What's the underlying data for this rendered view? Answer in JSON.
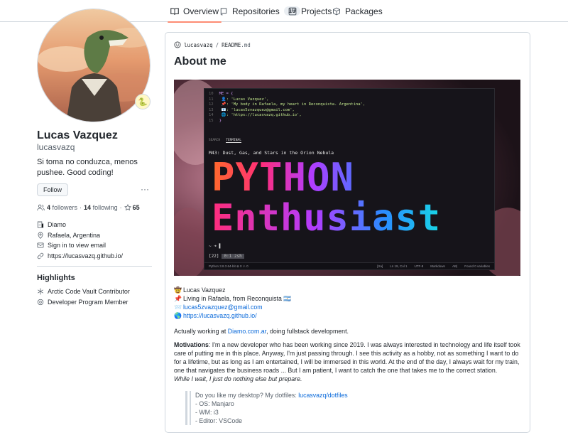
{
  "nav": {
    "tabs": [
      {
        "label": "Overview",
        "icon": "book-icon"
      },
      {
        "label": "Repositories",
        "icon": "repo-icon",
        "count": "19"
      },
      {
        "label": "Projects",
        "icon": "project-icon"
      },
      {
        "label": "Packages",
        "icon": "package-icon"
      }
    ]
  },
  "profile": {
    "status_emoji": "🐍",
    "fullname": "Lucas Vazquez",
    "username": "lucasvazq",
    "bio": "Si toma no conduzca, menos pushee. Good coding!",
    "follow_label": "Follow",
    "more_label": "···",
    "followers_count": "4",
    "followers_label": "followers",
    "following_count": "14",
    "following_label": "following",
    "stars_count": "65",
    "separator": "·",
    "company": "Diamo",
    "location": "Rafaela, Argentina",
    "email": "Sign in to view email",
    "website": "https://lucasvazq.github.io/"
  },
  "highlights": {
    "title": "Highlights",
    "items": [
      "Arctic Code Vault Contributor",
      "Developer Program Member"
    ]
  },
  "readme": {
    "path_user": "lucasvazq",
    "path_sep": "/",
    "path_file": "README",
    "path_ext": ".md",
    "heading": "About me",
    "banner": {
      "code_lines": [
        {
          "n": "10",
          "t": "ME = {"
        },
        {
          "n": "11",
          "t": "  👤: 'Lucas Vazquez',"
        },
        {
          "n": "12",
          "t": "  📌: 'My body in Rafaela, my heart in Reconquista. Argentina',"
        },
        {
          "n": "13",
          "t": "  📧: 'lucas5zvazquez@gmail.com',"
        },
        {
          "n": "14",
          "t": "  🌐: 'https://lucasvazq.github.io',"
        },
        {
          "n": "15",
          "t": "}"
        }
      ],
      "tab_search": "SEARCH",
      "tab_terminal": "TERMINAL",
      "caption": "M43: Dust, Gas, and Stars in the Orion Nebula",
      "big_line1": "PYTHON",
      "big_line2": "Enthusiast",
      "prompt": "~ ➜ ▌",
      "tmux_left": "[22]",
      "tmux_window": "0:1 zsh",
      "status_left": "Python 3.8.3 64-bit   ⊗ 0 ⚠ 0",
      "status_right": [
        "[Xa]",
        "Ln 19, Col 1",
        "UTF-8",
        "Markdown",
        "AB|",
        "Found 0 variables"
      ]
    },
    "contacts": [
      {
        "emoji": "🤠",
        "text": "Lucas Vazquez",
        "link": false
      },
      {
        "emoji": "📌",
        "text": "Living in Rafaela, from Reconquista 🇦🇷",
        "link": false
      },
      {
        "emoji": "📨",
        "text": "lucas5zvazquez@gmail.com",
        "link": true
      },
      {
        "emoji": "🌎",
        "text": "https://lucasvazq.github.io/",
        "link": true
      }
    ],
    "working_prefix": "Actually working at ",
    "working_link": "Diamo.com.ar",
    "working_suffix": ", doing fullstack development.",
    "motivations_label": "Motivations",
    "motivations_text": ": I'm a new developer who has been working since 2019. I was always interested in technology and life itself took care of putting me in this place. Anyway, I'm just passing through. I see this activity as a hobby, not as something I want to do for a lifetime, but as long as I am entertained, I will be immersed in this world. At the end of the day, I always wait for my train, one that navigates the business roads ... But I am patient, I want to catch the one that takes me to the correct station.",
    "motivations_italic": "While I wait, I just do nothing else but prepare.",
    "quote_prefix": "Do you like my desktop? My dotfiles: ",
    "quote_link": "lucasvazq/dotfiles",
    "quote_items": [
      "- OS: Manjaro",
      "- WM: i3",
      "- Editor: VSCode"
    ]
  },
  "colors": {
    "accent_tab": "#fd8c73",
    "link": "#0969da",
    "border": "#d0d7de",
    "muted": "#57606a"
  }
}
